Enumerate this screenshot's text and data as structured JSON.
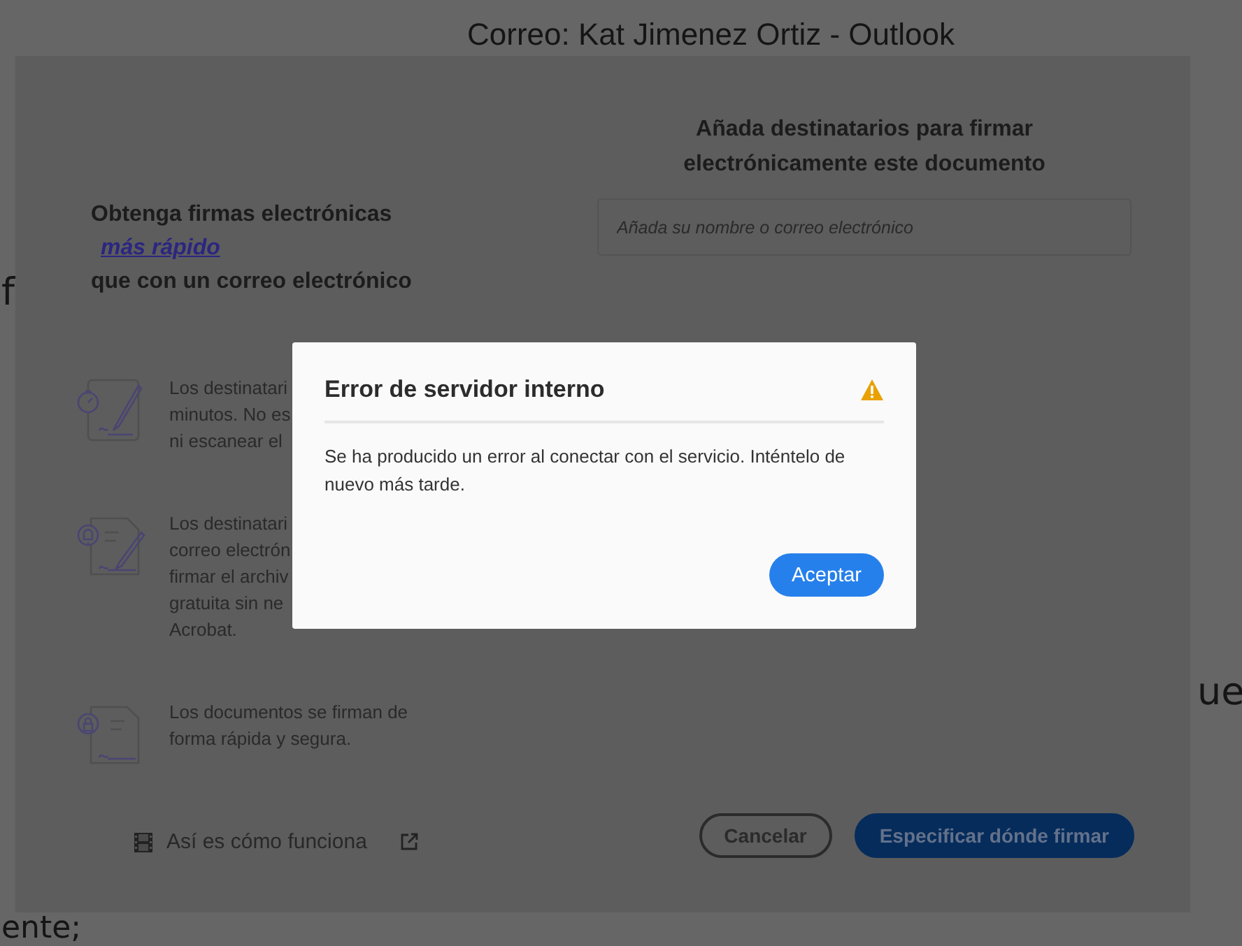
{
  "background_page": {
    "title": "Correo: Kat Jimenez Ortiz - Outlook",
    "fragments": [
      "f",
      "ente;",
      "ue"
    ]
  },
  "sign_panel": {
    "left": {
      "heading_line_1": "Obtenga firmas electrónicas",
      "heading_link": "más rápido",
      "heading_line_2": "que con un correo electrónico",
      "features": [
        {
          "lines": [
            "Los destinatari",
            "minutos. No es",
            "ni escanear el"
          ]
        },
        {
          "lines": [
            "Los destinatari",
            "correo electrón",
            "firmar el archiv",
            "gratuita sin ne",
            "Acrobat."
          ]
        },
        {
          "lines": [
            "Los documentos se firman de",
            "forma rápida y segura."
          ]
        }
      ],
      "how_it_works_link": "Así es cómo funciona"
    },
    "right": {
      "heading": "Añada destinatarios para firmar electrónicamente este documento",
      "recipient_field": {
        "placeholder": "Añada su nombre o correo electrónico"
      },
      "buttons": [
        {
          "label": "Cancelar",
          "kind": "secondary"
        },
        {
          "label": "Especificar dónde firmar",
          "kind": "primary"
        }
      ]
    }
  },
  "error_dialog": {
    "title": "Error de servidor interno",
    "message": "Se ha producido un error al conectar con el servicio. Inténtelo de nuevo más tarde.",
    "button": "Aceptar"
  }
}
